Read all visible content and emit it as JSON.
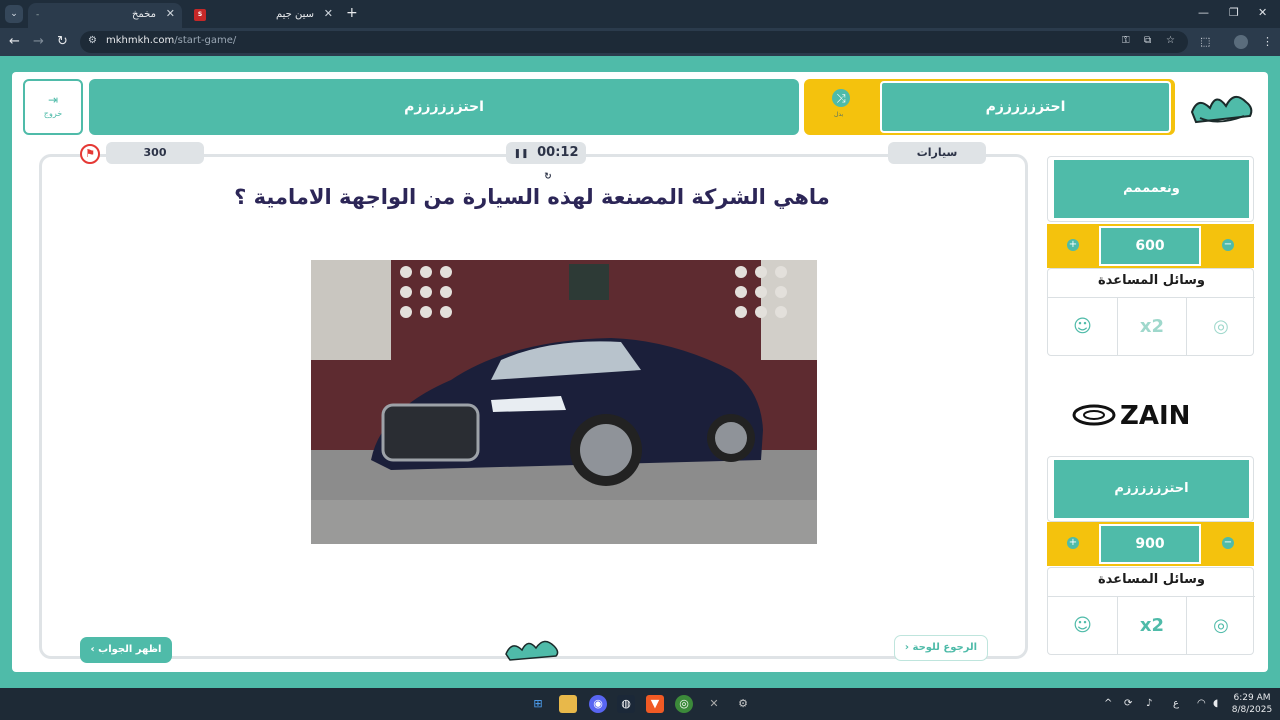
{
  "browser": {
    "tabs": [
      {
        "title": "مخمخ",
        "active": true
      },
      {
        "title": "سين جيم",
        "active": false
      }
    ],
    "url_host": "mkhmkh.com",
    "url_path": "/start-game/"
  },
  "header": {
    "exit_label": "خروج",
    "team_left": "احتززززززم",
    "team_right": "احتززززززم",
    "replace_label": "بدل"
  },
  "question": {
    "points": "300",
    "timer": "00:12",
    "category": "سيارات",
    "text": "ماهي الشركة المصنعة لهذه السيارة من الواجهة الامامية ؟",
    "back_label": "الرجوع للوحة",
    "reveal_label": "اظهر الجواب"
  },
  "teams": [
    {
      "name": "ونعمممم",
      "score": "600",
      "aids_title": "وسائل المساعدة"
    },
    {
      "name": "احتززززززم",
      "score": "900",
      "aids_title": "وسائل المساعدة"
    }
  ],
  "sponsor": "ZAIN",
  "taskbar": {
    "time": "6:29 AM",
    "date": "8/8/2025",
    "lang": "ع"
  },
  "colors": {
    "brand": "#4fbba9",
    "accent": "#f4c20d",
    "question": "#2c2657"
  }
}
